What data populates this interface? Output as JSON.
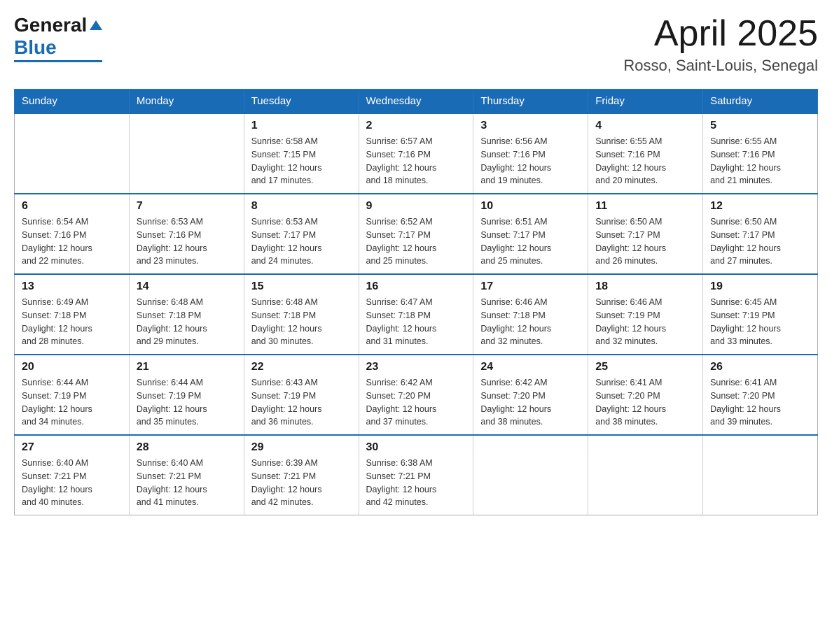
{
  "header": {
    "logo": {
      "general": "General",
      "blue": "Blue",
      "triangle": "▶"
    },
    "title": "April 2025",
    "location": "Rosso, Saint-Louis, Senegal"
  },
  "calendar": {
    "days": [
      "Sunday",
      "Monday",
      "Tuesday",
      "Wednesday",
      "Thursday",
      "Friday",
      "Saturday"
    ],
    "weeks": [
      [
        {
          "day": "",
          "info": ""
        },
        {
          "day": "",
          "info": ""
        },
        {
          "day": "1",
          "info": "Sunrise: 6:58 AM\nSunset: 7:15 PM\nDaylight: 12 hours\nand 17 minutes."
        },
        {
          "day": "2",
          "info": "Sunrise: 6:57 AM\nSunset: 7:16 PM\nDaylight: 12 hours\nand 18 minutes."
        },
        {
          "day": "3",
          "info": "Sunrise: 6:56 AM\nSunset: 7:16 PM\nDaylight: 12 hours\nand 19 minutes."
        },
        {
          "day": "4",
          "info": "Sunrise: 6:55 AM\nSunset: 7:16 PM\nDaylight: 12 hours\nand 20 minutes."
        },
        {
          "day": "5",
          "info": "Sunrise: 6:55 AM\nSunset: 7:16 PM\nDaylight: 12 hours\nand 21 minutes."
        }
      ],
      [
        {
          "day": "6",
          "info": "Sunrise: 6:54 AM\nSunset: 7:16 PM\nDaylight: 12 hours\nand 22 minutes."
        },
        {
          "day": "7",
          "info": "Sunrise: 6:53 AM\nSunset: 7:16 PM\nDaylight: 12 hours\nand 23 minutes."
        },
        {
          "day": "8",
          "info": "Sunrise: 6:53 AM\nSunset: 7:17 PM\nDaylight: 12 hours\nand 24 minutes."
        },
        {
          "day": "9",
          "info": "Sunrise: 6:52 AM\nSunset: 7:17 PM\nDaylight: 12 hours\nand 25 minutes."
        },
        {
          "day": "10",
          "info": "Sunrise: 6:51 AM\nSunset: 7:17 PM\nDaylight: 12 hours\nand 25 minutes."
        },
        {
          "day": "11",
          "info": "Sunrise: 6:50 AM\nSunset: 7:17 PM\nDaylight: 12 hours\nand 26 minutes."
        },
        {
          "day": "12",
          "info": "Sunrise: 6:50 AM\nSunset: 7:17 PM\nDaylight: 12 hours\nand 27 minutes."
        }
      ],
      [
        {
          "day": "13",
          "info": "Sunrise: 6:49 AM\nSunset: 7:18 PM\nDaylight: 12 hours\nand 28 minutes."
        },
        {
          "day": "14",
          "info": "Sunrise: 6:48 AM\nSunset: 7:18 PM\nDaylight: 12 hours\nand 29 minutes."
        },
        {
          "day": "15",
          "info": "Sunrise: 6:48 AM\nSunset: 7:18 PM\nDaylight: 12 hours\nand 30 minutes."
        },
        {
          "day": "16",
          "info": "Sunrise: 6:47 AM\nSunset: 7:18 PM\nDaylight: 12 hours\nand 31 minutes."
        },
        {
          "day": "17",
          "info": "Sunrise: 6:46 AM\nSunset: 7:18 PM\nDaylight: 12 hours\nand 32 minutes."
        },
        {
          "day": "18",
          "info": "Sunrise: 6:46 AM\nSunset: 7:19 PM\nDaylight: 12 hours\nand 32 minutes."
        },
        {
          "day": "19",
          "info": "Sunrise: 6:45 AM\nSunset: 7:19 PM\nDaylight: 12 hours\nand 33 minutes."
        }
      ],
      [
        {
          "day": "20",
          "info": "Sunrise: 6:44 AM\nSunset: 7:19 PM\nDaylight: 12 hours\nand 34 minutes."
        },
        {
          "day": "21",
          "info": "Sunrise: 6:44 AM\nSunset: 7:19 PM\nDaylight: 12 hours\nand 35 minutes."
        },
        {
          "day": "22",
          "info": "Sunrise: 6:43 AM\nSunset: 7:19 PM\nDaylight: 12 hours\nand 36 minutes."
        },
        {
          "day": "23",
          "info": "Sunrise: 6:42 AM\nSunset: 7:20 PM\nDaylight: 12 hours\nand 37 minutes."
        },
        {
          "day": "24",
          "info": "Sunrise: 6:42 AM\nSunset: 7:20 PM\nDaylight: 12 hours\nand 38 minutes."
        },
        {
          "day": "25",
          "info": "Sunrise: 6:41 AM\nSunset: 7:20 PM\nDaylight: 12 hours\nand 38 minutes."
        },
        {
          "day": "26",
          "info": "Sunrise: 6:41 AM\nSunset: 7:20 PM\nDaylight: 12 hours\nand 39 minutes."
        }
      ],
      [
        {
          "day": "27",
          "info": "Sunrise: 6:40 AM\nSunset: 7:21 PM\nDaylight: 12 hours\nand 40 minutes."
        },
        {
          "day": "28",
          "info": "Sunrise: 6:40 AM\nSunset: 7:21 PM\nDaylight: 12 hours\nand 41 minutes."
        },
        {
          "day": "29",
          "info": "Sunrise: 6:39 AM\nSunset: 7:21 PM\nDaylight: 12 hours\nand 42 minutes."
        },
        {
          "day": "30",
          "info": "Sunrise: 6:38 AM\nSunset: 7:21 PM\nDaylight: 12 hours\nand 42 minutes."
        },
        {
          "day": "",
          "info": ""
        },
        {
          "day": "",
          "info": ""
        },
        {
          "day": "",
          "info": ""
        }
      ]
    ]
  }
}
